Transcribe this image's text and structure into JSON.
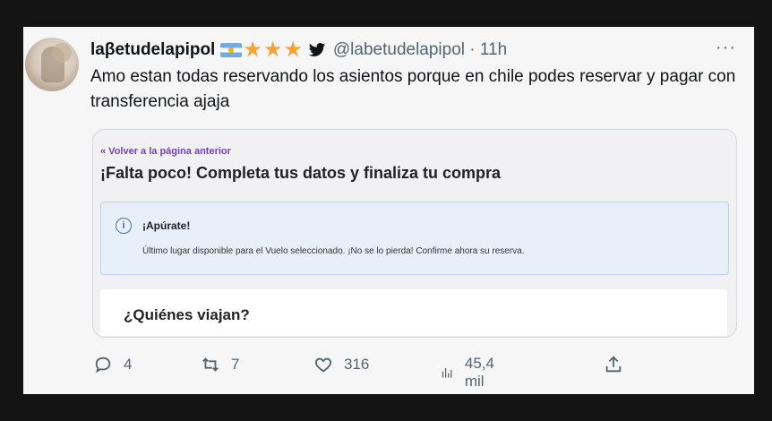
{
  "tweet": {
    "display_name": "laβetudelapipol",
    "handle_time": "@labetudelapipol · 11h",
    "more_label": "···",
    "text": "Amo estan todas reservando los asientos porque en chile podes reservar y pagar con transferencia ajaja",
    "icons": {
      "flag": "argentina-flag",
      "stars": "star-icon",
      "platform": "twitter-bird-icon"
    },
    "colors": {
      "star": "#f2a33a",
      "link_purple": "#6f42c1"
    }
  },
  "card": {
    "back_link": "« Volver a la página anterior",
    "title": "¡Falta poco! Completa tus datos y finaliza tu compra",
    "alert": {
      "title": "¡Apúrate!",
      "text": "Último lugar disponible para el Vuelo seleccionado. ¡No se lo pierda! Confirme ahora su reserva."
    },
    "section_title": "¿Quiénes viajan?"
  },
  "actions": {
    "replies": "4",
    "retweets": "7",
    "likes": "316",
    "views": "45,4 mil"
  }
}
